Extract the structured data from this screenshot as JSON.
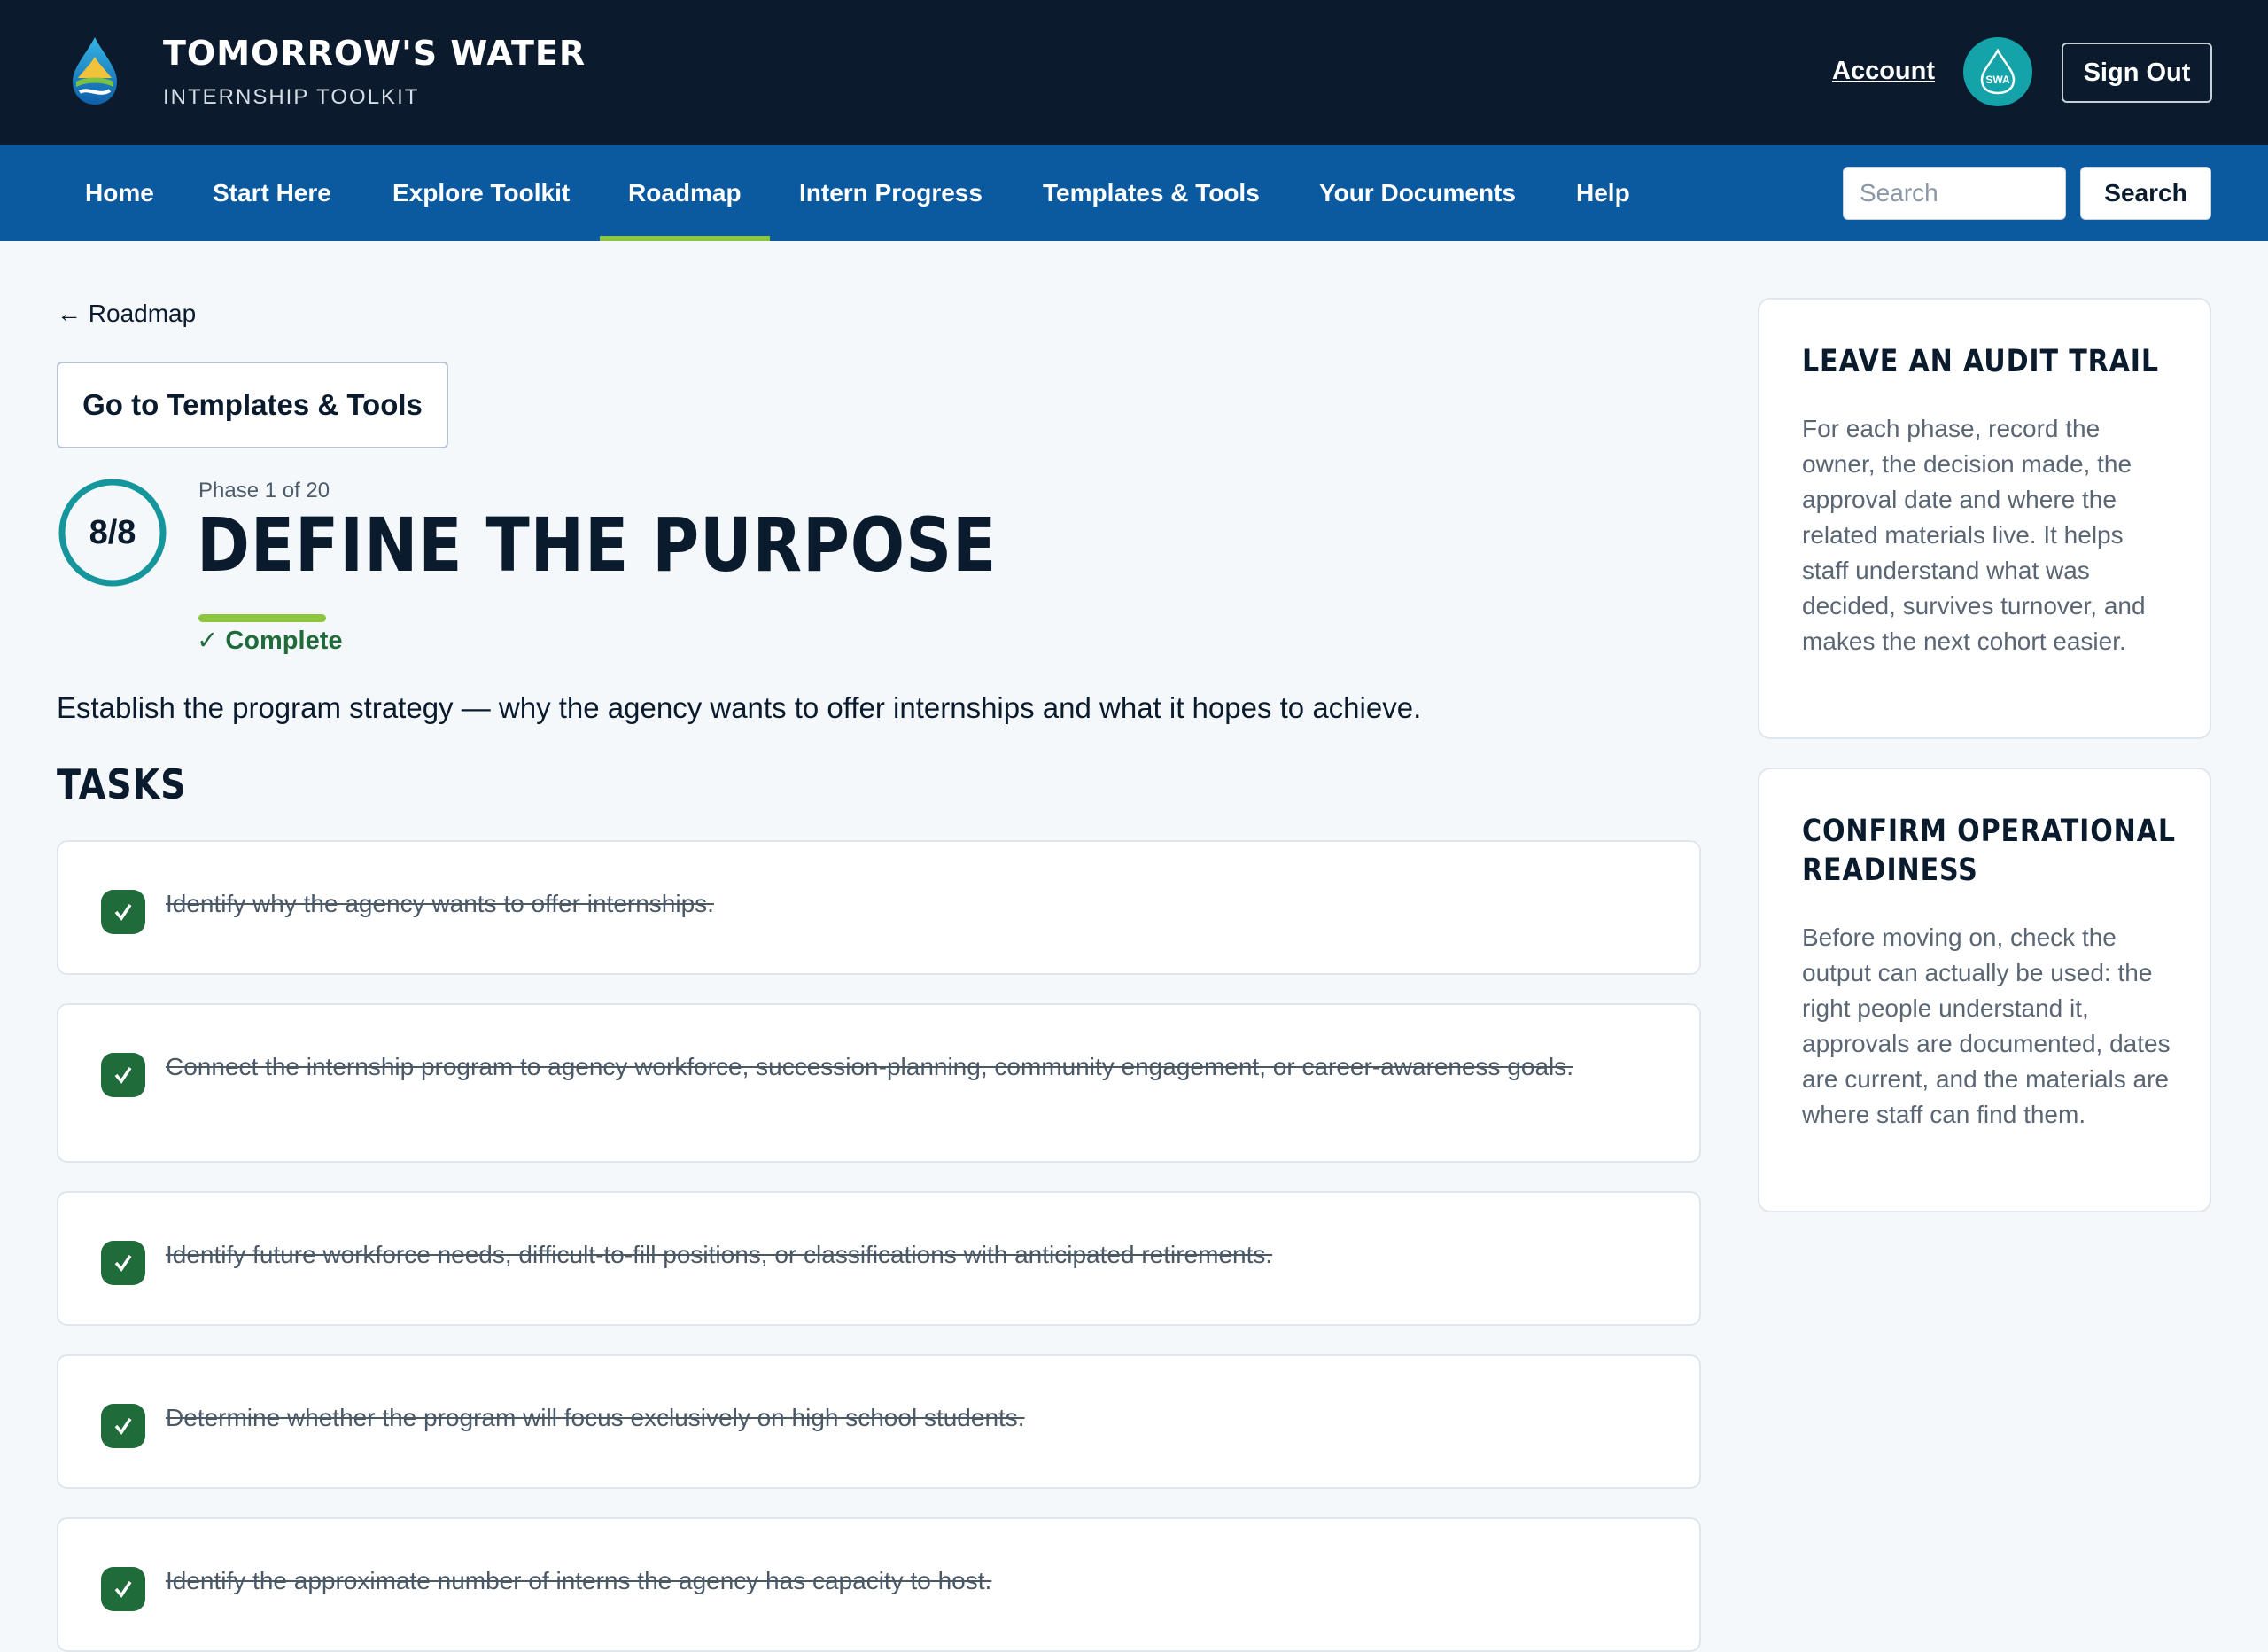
{
  "header": {
    "brand_title": "TOMORROW'S WATER",
    "brand_subtitle": "INTERNSHIP TOOLKIT",
    "account_label": "Account",
    "avatar_text": "SWA",
    "signout_label": "Sign Out"
  },
  "nav": {
    "items": [
      {
        "label": "Home"
      },
      {
        "label": "Start Here"
      },
      {
        "label": "Explore Toolkit"
      },
      {
        "label": "Roadmap",
        "active": true
      },
      {
        "label": "Intern Progress"
      },
      {
        "label": "Templates & Tools"
      },
      {
        "label": "Your Documents"
      },
      {
        "label": "Help"
      }
    ],
    "search_placeholder": "Search",
    "search_button": "Search"
  },
  "main": {
    "back_link": "← Roadmap",
    "templates_button": "Go to Templates & Tools",
    "progress": {
      "completed": 8,
      "total": 8,
      "label": "8/8"
    },
    "phase_label": "Phase 1 of 20",
    "phase_title": "DEFINE THE PURPOSE",
    "status": "✓ Complete",
    "description": "Establish the program strategy — why the agency wants to offer internships and what it hopes to achieve.",
    "tasks_heading": "TASKS",
    "tasks": [
      {
        "text": "Identify why the agency wants to offer internships.",
        "done": true
      },
      {
        "text": "Connect the internship program to agency workforce, succession-planning, community engagement, or career-awareness goals.",
        "done": true
      },
      {
        "text": "Identify future workforce needs, difficult-to-fill positions, or classifications with anticipated retirements.",
        "done": true
      },
      {
        "text": "Determine whether the program will focus exclusively on high school students.",
        "done": true
      },
      {
        "text": "Identify the approximate number of interns the agency has capacity to host.",
        "done": true
      }
    ]
  },
  "sidebar": {
    "cards": [
      {
        "title": "LEAVE AN AUDIT TRAIL",
        "body": "For each phase, record the owner, the decision made, the approval date and where the related materials live. It helps staff understand what was decided, survives turnover, and makes the next cohort easier."
      },
      {
        "title": "CONFIRM OPERATIONAL READINESS",
        "body": "Before moving on, check the output can actually be used: the right people understand it, approvals are documented, dates are current, and the materials are where staff can find them."
      }
    ]
  },
  "colors": {
    "header_bg": "#0b1a2c",
    "nav_bg": "#0b5aa0",
    "accent_green": "#8cc63f",
    "check_green": "#1f6b3a",
    "ring_teal": "#14969c"
  },
  "icons": {
    "logo": "water-drop-logo-icon",
    "task_check": "check-icon"
  }
}
